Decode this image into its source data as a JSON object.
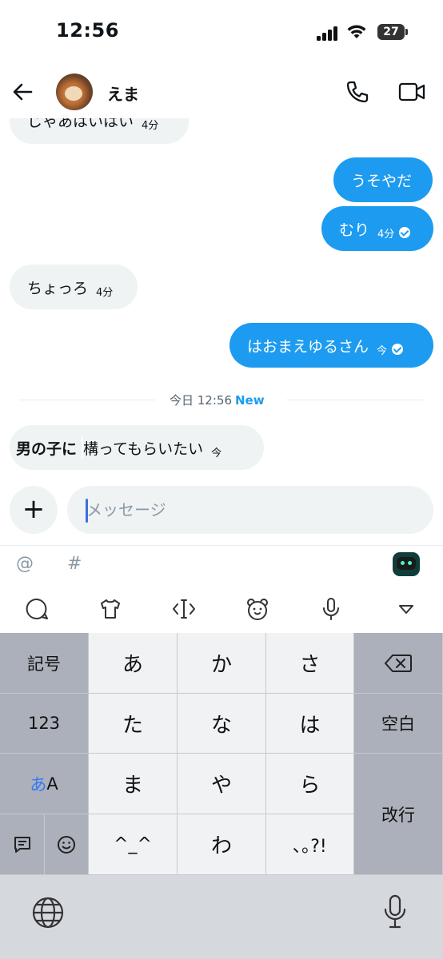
{
  "status_bar": {
    "time": "12:56",
    "battery": "27"
  },
  "header": {
    "name": "えま"
  },
  "messages": [
    {
      "dir": "in",
      "text": "じゃあはいはい",
      "time": "4分"
    },
    {
      "dir": "out",
      "text": "うそやだ",
      "time": ""
    },
    {
      "dir": "out",
      "text": "むり",
      "time": "4分"
    },
    {
      "dir": "in",
      "text": "ちょっろ",
      "time": "4分"
    },
    {
      "dir": "out",
      "text": "はおまえゆるさん",
      "time": "今"
    },
    {
      "dir": "in",
      "text_bold": "男の子に",
      "text": "構ってもらいたい",
      "time": "今"
    }
  ],
  "divider": {
    "label": "今日 12:56",
    "new_label": "New"
  },
  "composer": {
    "placeholder": "メッセージ",
    "plus": "+"
  },
  "suggestions": {
    "at": "@",
    "hash": "#"
  },
  "keyboard": {
    "left_keys": [
      "記号",
      "123"
    ],
    "kana_label_1": "あ",
    "kana_label_2": "A",
    "rows": [
      [
        "あ",
        "か",
        "さ"
      ],
      [
        "た",
        "な",
        "は"
      ],
      [
        "ま",
        "や",
        "ら"
      ],
      [
        "^_^",
        "わ",
        "､｡?!"
      ]
    ],
    "space": "空白",
    "return": "改行"
  }
}
